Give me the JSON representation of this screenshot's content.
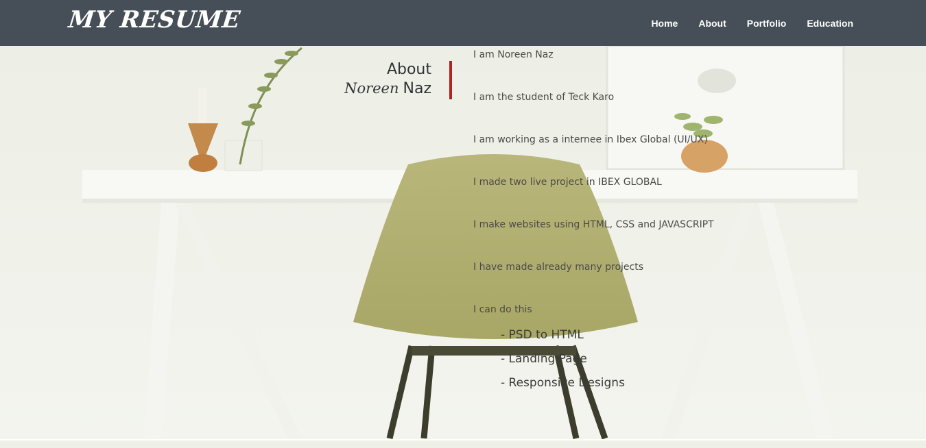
{
  "header": {
    "brand": "MY RESUME",
    "nav": [
      {
        "label": "Home"
      },
      {
        "label": "About"
      },
      {
        "label": "Portfolio"
      },
      {
        "label": "Education"
      }
    ]
  },
  "about": {
    "title_line1": "About",
    "title_script": "Noreen",
    "title_rest": "Naz",
    "facts": [
      "I am Noreen Naz",
      "I am the student of Teck Karo",
      "I am working as a internee in Ibex Global (UI/UX)",
      "I made two live project in IBEX GLOBAL",
      "I make websites using HTML, CSS and JAVASCRIPT",
      "I have made already many projects",
      "I can do this"
    ],
    "skills": [
      "- PSD to HTML",
      "- Landing Page",
      "- Responsive Designs"
    ]
  },
  "colors": {
    "navbar": "#464e57",
    "accent_bar": "#b12222",
    "background": "#eef0e7"
  }
}
